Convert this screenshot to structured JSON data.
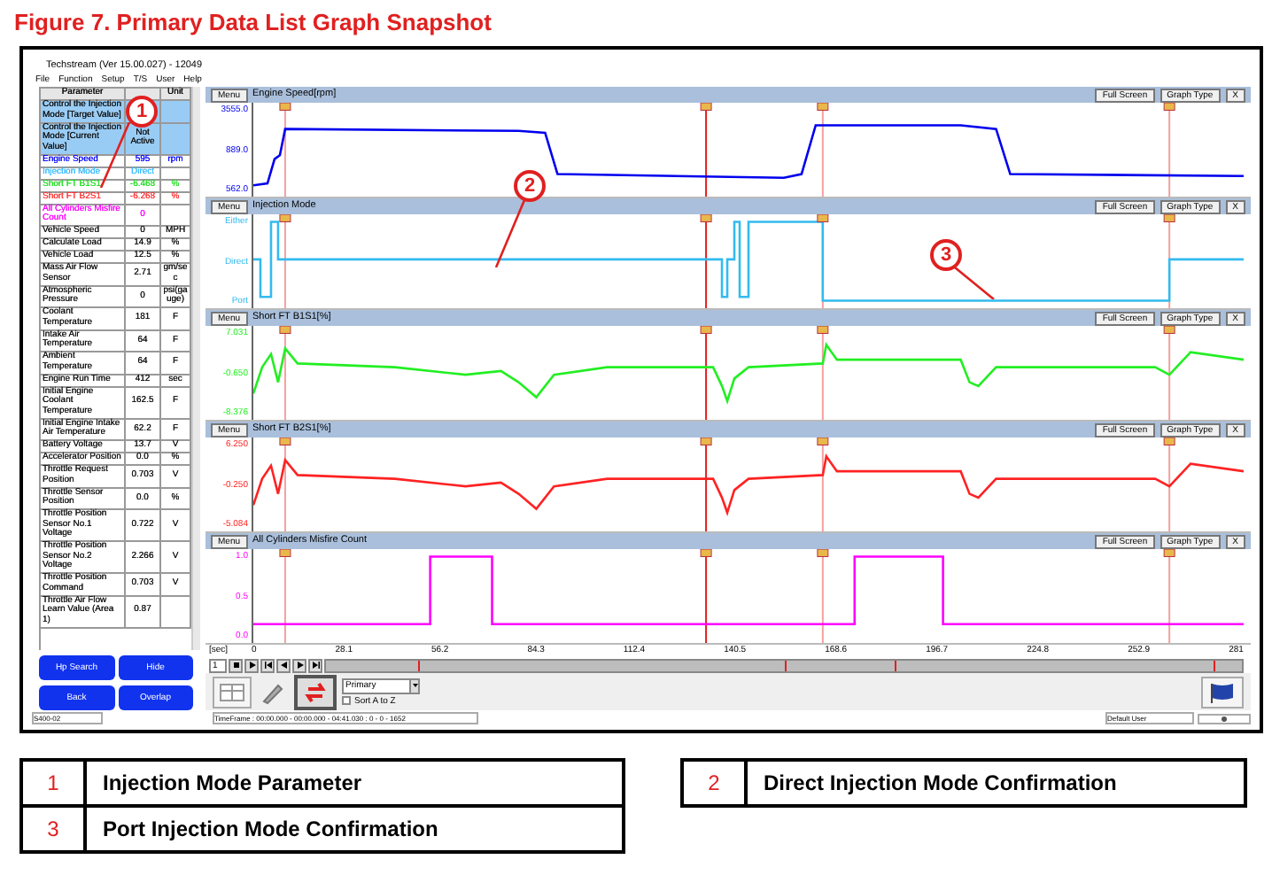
{
  "figure_title": "Figure 7. Primary Data List Graph Snapshot",
  "window": {
    "title": "Techstream (Ver 15.00.027) - 12049"
  },
  "menu": [
    "File",
    "Function",
    "Setup",
    "T/S",
    "User",
    "Help"
  ],
  "table": {
    "columns": [
      "Parameter",
      "Unit"
    ],
    "rows": [
      {
        "name": "Control the Injection Mode [Target Value]",
        "value": "",
        "unit": "",
        "selected": true
      },
      {
        "name": "Control the Injection Mode [Current Value]",
        "value": "Not Active",
        "unit": "",
        "selected": true
      },
      {
        "name": "Engine Speed",
        "value": "595",
        "unit": "rpm",
        "selected": false,
        "color": "#0000ff"
      },
      {
        "name": "Injection Mode",
        "value": "Direct",
        "unit": "",
        "selected": false,
        "color": "#33bbff"
      },
      {
        "name": "Short FT B1S1",
        "value": "-6.468",
        "unit": "%",
        "selected": false,
        "color": "#22dd22"
      },
      {
        "name": "Short FT B2S1",
        "value": "-6.268",
        "unit": "%",
        "selected": false,
        "color": "#ff3333"
      },
      {
        "name": "All Cylinders Misfire Count",
        "value": "0",
        "unit": "",
        "selected": false,
        "color": "#ff00ff"
      },
      {
        "name": "Vehicle Speed",
        "value": "0",
        "unit": "MPH",
        "selected": false
      },
      {
        "name": "Calculate Load",
        "value": "14.9",
        "unit": "%",
        "selected": false
      },
      {
        "name": "Vehicle Load",
        "value": "12.5",
        "unit": "%",
        "selected": false
      },
      {
        "name": "Mass Air Flow Sensor",
        "value": "2.71",
        "unit": "gm/sec",
        "selected": false
      },
      {
        "name": "Atmospheric Pressure",
        "value": "0",
        "unit": "psi(gauge)",
        "selected": false
      },
      {
        "name": "Coolant Temperature",
        "value": "181",
        "unit": "F",
        "selected": false
      },
      {
        "name": "Intake Air Temperature",
        "value": "64",
        "unit": "F",
        "selected": false
      },
      {
        "name": "Ambient Temperature",
        "value": "64",
        "unit": "F",
        "selected": false
      },
      {
        "name": "Engine Run Time",
        "value": "412",
        "unit": "sec",
        "selected": false
      },
      {
        "name": "Initial Engine Coolant Temperature",
        "value": "162.5",
        "unit": "F",
        "selected": false
      },
      {
        "name": "Initial Engine Intake Air Temperature",
        "value": "62.2",
        "unit": "F",
        "selected": false
      },
      {
        "name": "Battery Voltage",
        "value": "13.7",
        "unit": "V",
        "selected": false
      },
      {
        "name": "Accelerator Position",
        "value": "0.0",
        "unit": "%",
        "selected": false
      },
      {
        "name": "Throttle Request Position",
        "value": "0.703",
        "unit": "V",
        "selected": false
      },
      {
        "name": "Throttle Sensor Position",
        "value": "0.0",
        "unit": "%",
        "selected": false
      },
      {
        "name": "Throttle Position Sensor No.1 Voltage",
        "value": "0.722",
        "unit": "V",
        "selected": false
      },
      {
        "name": "Throttle Position Sensor No.2 Voltage",
        "value": "2.266",
        "unit": "V",
        "selected": false
      },
      {
        "name": "Throttle Position Command",
        "value": "0.703",
        "unit": "V",
        "selected": false
      },
      {
        "name": "Throttle Air Flow Learn Value (Area 1)",
        "value": "0.87",
        "unit": "",
        "selected": false
      }
    ]
  },
  "graphs": [
    {
      "title": "Engine Speed[rpm]",
      "kind": "speed",
      "color": "#0000ee",
      "y_labels": [
        "3555.0",
        "889.0",
        "562.0"
      ],
      "menu": "Menu",
      "full_screen": "Full Screen",
      "graph_type": "Graph Type",
      "close": "X"
    },
    {
      "title": "Injection Mode",
      "kind": "mode",
      "color": "#33bbee",
      "y_labels": [
        "Either",
        "Direct",
        "Port"
      ],
      "menu": "Menu",
      "full_screen": "Full Screen",
      "graph_type": "Graph Type",
      "close": "X"
    },
    {
      "title": "Short FT B1S1[%]",
      "kind": "trim",
      "color": "#22ee22",
      "y_labels": [
        "7.031",
        "-0.650",
        "-8.376"
      ],
      "menu": "Menu",
      "full_screen": "Full Screen",
      "graph_type": "Graph Type",
      "close": "X"
    },
    {
      "title": "Short FT B2S1[%]",
      "kind": "trim",
      "color": "#ff2222",
      "y_labels": [
        "6.250",
        "-0.250",
        "-5.084"
      ],
      "menu": "Menu",
      "full_screen": "Full Screen",
      "graph_type": "Graph Type",
      "close": "X"
    },
    {
      "title": "All Cylinders Misfire Count",
      "kind": "misfire",
      "color": "#ff00ff",
      "y_labels": [
        "1.0",
        "0.5",
        "0.0"
      ],
      "menu": "Menu",
      "full_screen": "Full Screen",
      "graph_type": "Graph Type",
      "close": "X"
    }
  ],
  "x_axis": {
    "unit": "[sec]",
    "labels": [
      "0",
      "28.1",
      "56.2",
      "84.3",
      "112.4",
      "140.5",
      "168.6",
      "196.7",
      "224.8",
      "252.9",
      "281"
    ]
  },
  "playback": {
    "speed": "1"
  },
  "side_buttons": [
    "Hp Search",
    "Hide",
    "Back",
    "Overlap"
  ],
  "toolbar": {
    "dropdown": "Primary",
    "sort": {
      "label": "Sort A to Z",
      "checked": false
    }
  },
  "status_bar": {
    "left": "S400-02",
    "center": "TimeFrame : 00:00.000 - 00:00.000 - 04:41.030 : 0 - 0 - 1652",
    "right": "Default User"
  },
  "callouts": [
    "1",
    "2",
    "3"
  ],
  "legend": [
    {
      "number": "1",
      "text": "Injection Mode Parameter"
    },
    {
      "number": "2",
      "text": "Direct Injection Mode Confirmation"
    },
    {
      "number": "3",
      "text": "Port Injection Mode Confirmation"
    }
  ]
}
